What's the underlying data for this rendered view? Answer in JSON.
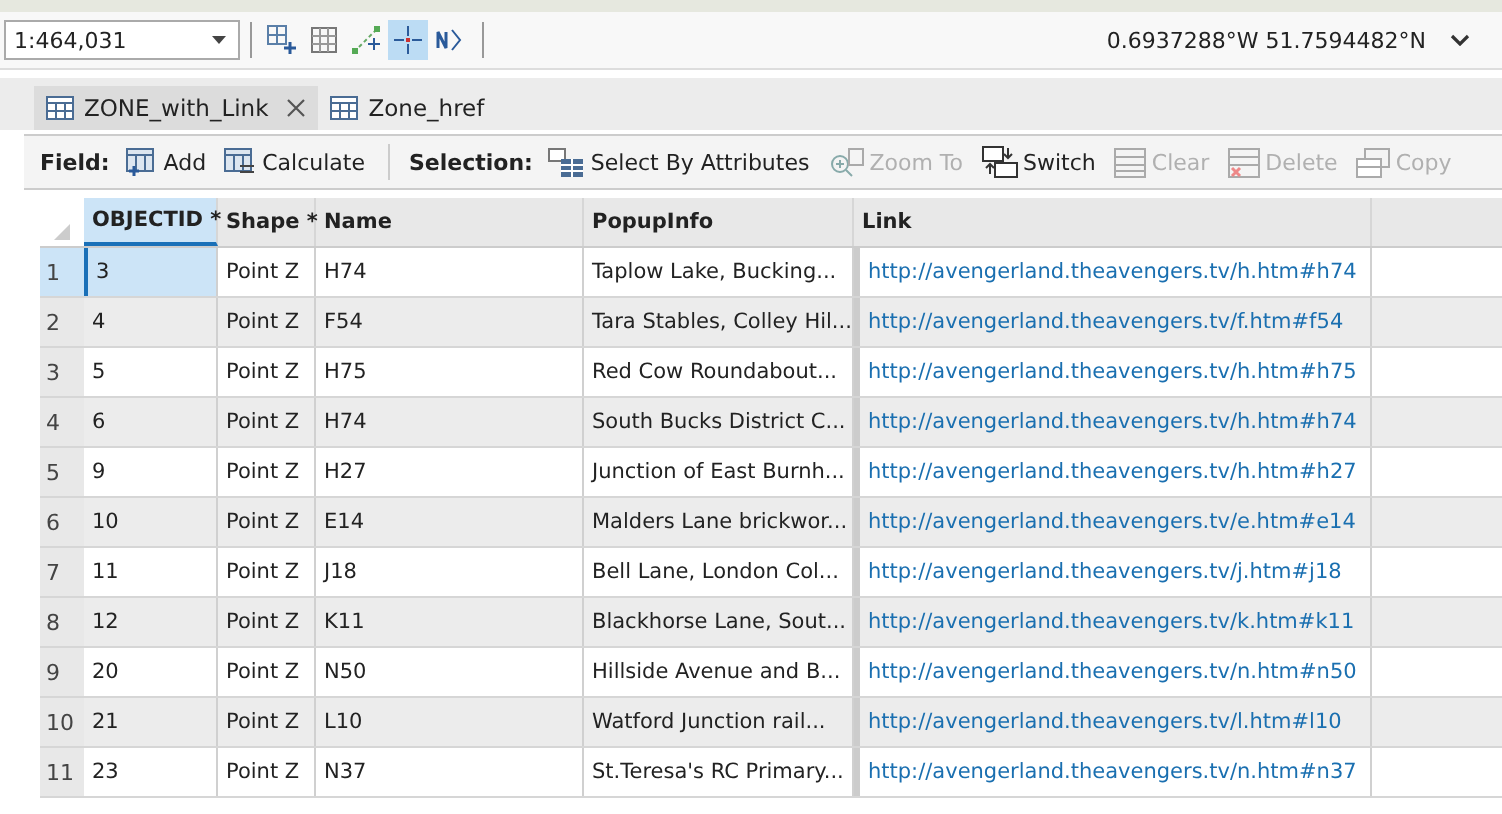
{
  "map_toolbar": {
    "scale": "1:464,031",
    "tools": [
      {
        "kind": "grid-plus",
        "selected": false
      },
      {
        "kind": "grid",
        "selected": false
      },
      {
        "kind": "snap",
        "selected": false
      },
      {
        "kind": "crosshair",
        "selected": true
      },
      {
        "kind": "north",
        "selected": false
      }
    ],
    "coordinates": "0.6937288°W 51.7594482°N"
  },
  "tabs": [
    {
      "label": "ZONE_with_Link",
      "selected": true,
      "closable": true
    },
    {
      "label": "Zone_href",
      "selected": false,
      "closable": false
    }
  ],
  "toolbar": {
    "groups": [
      {
        "label": "Field:",
        "buttons": [
          {
            "label": "Add",
            "kind": "add",
            "disabled": false
          },
          {
            "label": "Calculate",
            "kind": "calculate",
            "disabled": false
          }
        ]
      },
      {
        "label": "Selection:",
        "buttons": [
          {
            "label": "Select By Attributes",
            "kind": "select",
            "disabled": false
          },
          {
            "label": "Zoom To",
            "kind": "zoom",
            "disabled": true
          },
          {
            "label": "Switch",
            "kind": "switch",
            "disabled": false
          },
          {
            "label": "Clear",
            "kind": "clear",
            "disabled": true
          },
          {
            "label": "Delete",
            "kind": "delete",
            "disabled": true
          },
          {
            "label": "Copy",
            "kind": "copy",
            "disabled": true
          }
        ]
      }
    ]
  },
  "table": {
    "columns": [
      "OBJECTID *",
      "Shape *",
      "Name",
      "PopupInfo",
      "Link"
    ],
    "rows": [
      {
        "num": "1",
        "cells": [
          "3",
          "Point Z",
          "H74",
          "Taplow Lake, Bucking...",
          "http://avengerland.theavengers.tv/h.htm#h74"
        ],
        "selected": true
      },
      {
        "num": "2",
        "cells": [
          "4",
          "Point Z",
          "F54",
          "Tara Stables, Colley Hil...",
          "http://avengerland.theavengers.tv/f.htm#f54"
        ],
        "selected": false
      },
      {
        "num": "3",
        "cells": [
          "5",
          "Point Z",
          "H75",
          "Red Cow Roundabout...",
          "http://avengerland.theavengers.tv/h.htm#h75"
        ],
        "selected": false
      },
      {
        "num": "4",
        "cells": [
          "6",
          "Point Z",
          "H74",
          "South Bucks District C...",
          "http://avengerland.theavengers.tv/h.htm#h74"
        ],
        "selected": false
      },
      {
        "num": "5",
        "cells": [
          "9",
          "Point Z",
          "H27",
          "Junction of East Burnh...",
          "http://avengerland.theavengers.tv/h.htm#h27"
        ],
        "selected": false
      },
      {
        "num": "6",
        "cells": [
          "10",
          "Point Z",
          "E14",
          "Malders Lane brickwor...",
          "http://avengerland.theavengers.tv/e.htm#e14"
        ],
        "selected": false
      },
      {
        "num": "7",
        "cells": [
          "11",
          "Point Z",
          "J18",
          "Bell Lane, London Col...",
          "http://avengerland.theavengers.tv/j.htm#j18"
        ],
        "selected": false
      },
      {
        "num": "8",
        "cells": [
          "12",
          "Point Z",
          "K11",
          "Blackhorse Lane, Sout...",
          "http://avengerland.theavengers.tv/k.htm#k11"
        ],
        "selected": false
      },
      {
        "num": "9",
        "cells": [
          "20",
          "Point Z",
          "N50",
          "Hillside Avenue and B...",
          "http://avengerland.theavengers.tv/n.htm#n50"
        ],
        "selected": false
      },
      {
        "num": "10",
        "cells": [
          "21",
          "Point Z",
          "L10",
          "Watford Junction rail...",
          "http://avengerland.theavengers.tv/l.htm#l10"
        ],
        "selected": false
      },
      {
        "num": "11",
        "cells": [
          "23",
          "Point Z",
          "N37",
          "St.Teresa's RC Primary...",
          "http://avengerland.theavengers.tv/n.htm#n37"
        ],
        "selected": false
      }
    ]
  }
}
